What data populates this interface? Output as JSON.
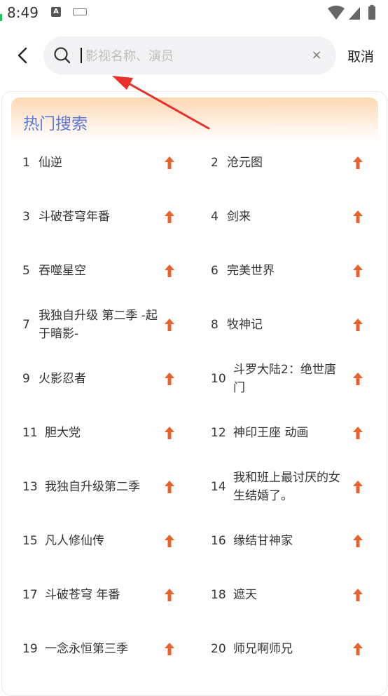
{
  "status": {
    "time": "8:49"
  },
  "search": {
    "placeholder": "影视名称、演员",
    "value": "",
    "cancel_label": "取消",
    "clear_symbol": "×"
  },
  "hot": {
    "title": "热门搜索",
    "items": [
      {
        "rank": "1",
        "name": "仙逆"
      },
      {
        "rank": "2",
        "name": "沧元图"
      },
      {
        "rank": "3",
        "name": "斗破苍穹年番"
      },
      {
        "rank": "4",
        "name": "剑来"
      },
      {
        "rank": "5",
        "name": "吞噬星空"
      },
      {
        "rank": "6",
        "name": "完美世界"
      },
      {
        "rank": "7",
        "name": "我独自升级 第二季 -起于暗影-"
      },
      {
        "rank": "8",
        "name": "牧神记"
      },
      {
        "rank": "9",
        "name": "火影忍者"
      },
      {
        "rank": "10",
        "name": "斗罗大陆2：绝世唐门"
      },
      {
        "rank": "11",
        "name": "胆大党"
      },
      {
        "rank": "12",
        "name": "神印王座 动画"
      },
      {
        "rank": "13",
        "name": "我独自升级第二季"
      },
      {
        "rank": "14",
        "name": "我和班上最讨厌的女生结婚了。"
      },
      {
        "rank": "15",
        "name": "凡人修仙传"
      },
      {
        "rank": "16",
        "name": "缘结甘神家"
      },
      {
        "rank": "17",
        "name": "斗破苍穹 年番"
      },
      {
        "rank": "18",
        "name": "遮天"
      },
      {
        "rank": "19",
        "name": "一念永恒第三季"
      },
      {
        "rank": "20",
        "name": "师兄啊师兄"
      }
    ]
  },
  "colors": {
    "accent": "#5b79d9",
    "up_arrow": "#e8622c",
    "annotation": "#e8312a"
  }
}
